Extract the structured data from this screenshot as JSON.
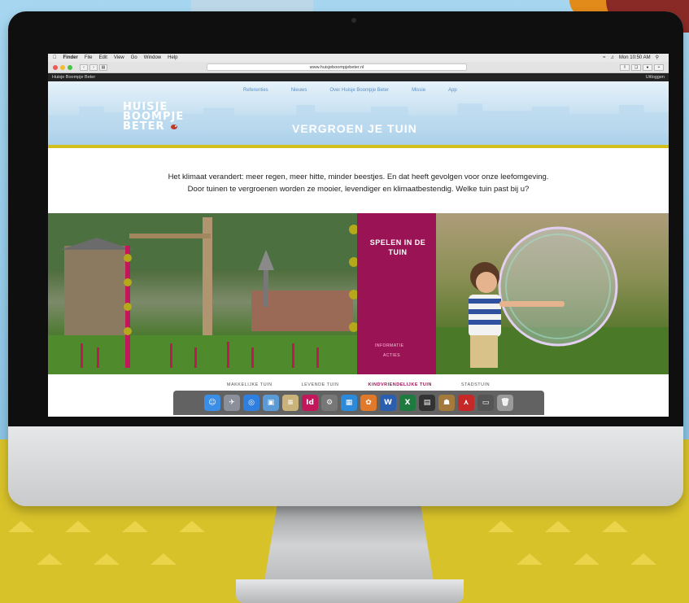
{
  "menubar": {
    "items": [
      "Finder",
      "File",
      "Edit",
      "View",
      "Go",
      "Window",
      "Help"
    ],
    "clock": "Mon 10:50 AM"
  },
  "browser": {
    "url": "www.huisjeboompjebeter.nl"
  },
  "adminbar": {
    "site": "Huisje Boompje Beter",
    "logout": "Uitloggen"
  },
  "site": {
    "nav": [
      "Referenties",
      "Nieuws",
      "Over Huisje Boompje Beter",
      "Missie",
      "App"
    ],
    "logo_lines": [
      "HUISJE",
      "BOOMPJE",
      "BETER"
    ],
    "page_title": "VERGROEN JE TUIN",
    "intro_line1": "Het klimaat verandert: meer regen, meer hitte, minder beestjes. En dat heeft gevolgen voor onze leefomgeving.",
    "intro_line2": "Door tuinen te vergroenen worden ze mooier, levendiger en klimaatbestendig. Welke tuin past bij u?",
    "panel": {
      "title": "SPELEN IN DE TUIN",
      "link1": "INFORMATIE",
      "link2": "ACTIES",
      "color": "#9a1354"
    },
    "tabs": [
      "MAKKELIJKE TUIN",
      "LEVENDE TUIN",
      "KINDVRIENDELIJKE TUIN",
      "STADSTUIN"
    ],
    "active_tab": "KINDVRIENDELIJKE TUIN"
  },
  "dock": {
    "apps": [
      {
        "icon": "finder-icon",
        "color": "#3a8ee6",
        "glyph": "☺"
      },
      {
        "icon": "launchpad-icon",
        "color": "#8a8f99",
        "glyph": "✈"
      },
      {
        "icon": "safari-icon",
        "color": "#2f7fe0",
        "glyph": "◎"
      },
      {
        "icon": "preview-icon",
        "color": "#5a9ad6",
        "glyph": "▣"
      },
      {
        "icon": "notes-icon",
        "color": "#c9b37a",
        "glyph": "≡"
      },
      {
        "icon": "indesign-icon",
        "color": "#c2185b",
        "glyph": "Id"
      },
      {
        "icon": "system-preferences-icon",
        "color": "#777",
        "glyph": "⚙"
      },
      {
        "icon": "photos-app-icon",
        "color": "#2b8ad9",
        "glyph": "▦"
      },
      {
        "icon": "photos-icon",
        "color": "#e07a2a",
        "glyph": "✿"
      },
      {
        "icon": "word-icon",
        "color": "#2a5fb0",
        "glyph": "W"
      },
      {
        "icon": "excel-icon",
        "color": "#1f7a3f",
        "glyph": "X"
      },
      {
        "icon": "printer-icon",
        "color": "#333",
        "glyph": "▤"
      },
      {
        "icon": "contacts-icon",
        "color": "#a47a3c",
        "glyph": "☗"
      },
      {
        "icon": "acrobat-icon",
        "color": "#c62828",
        "glyph": "⋏"
      },
      {
        "icon": "image-capture-icon",
        "color": "#555",
        "glyph": "▭"
      },
      {
        "icon": "trash-icon",
        "color": "#9a9a9a",
        "glyph": "🗑"
      }
    ]
  },
  "colors": {
    "accent": "#9a1354",
    "yellow": "#d2bf1c",
    "header_blue": "#a9d0ea"
  }
}
